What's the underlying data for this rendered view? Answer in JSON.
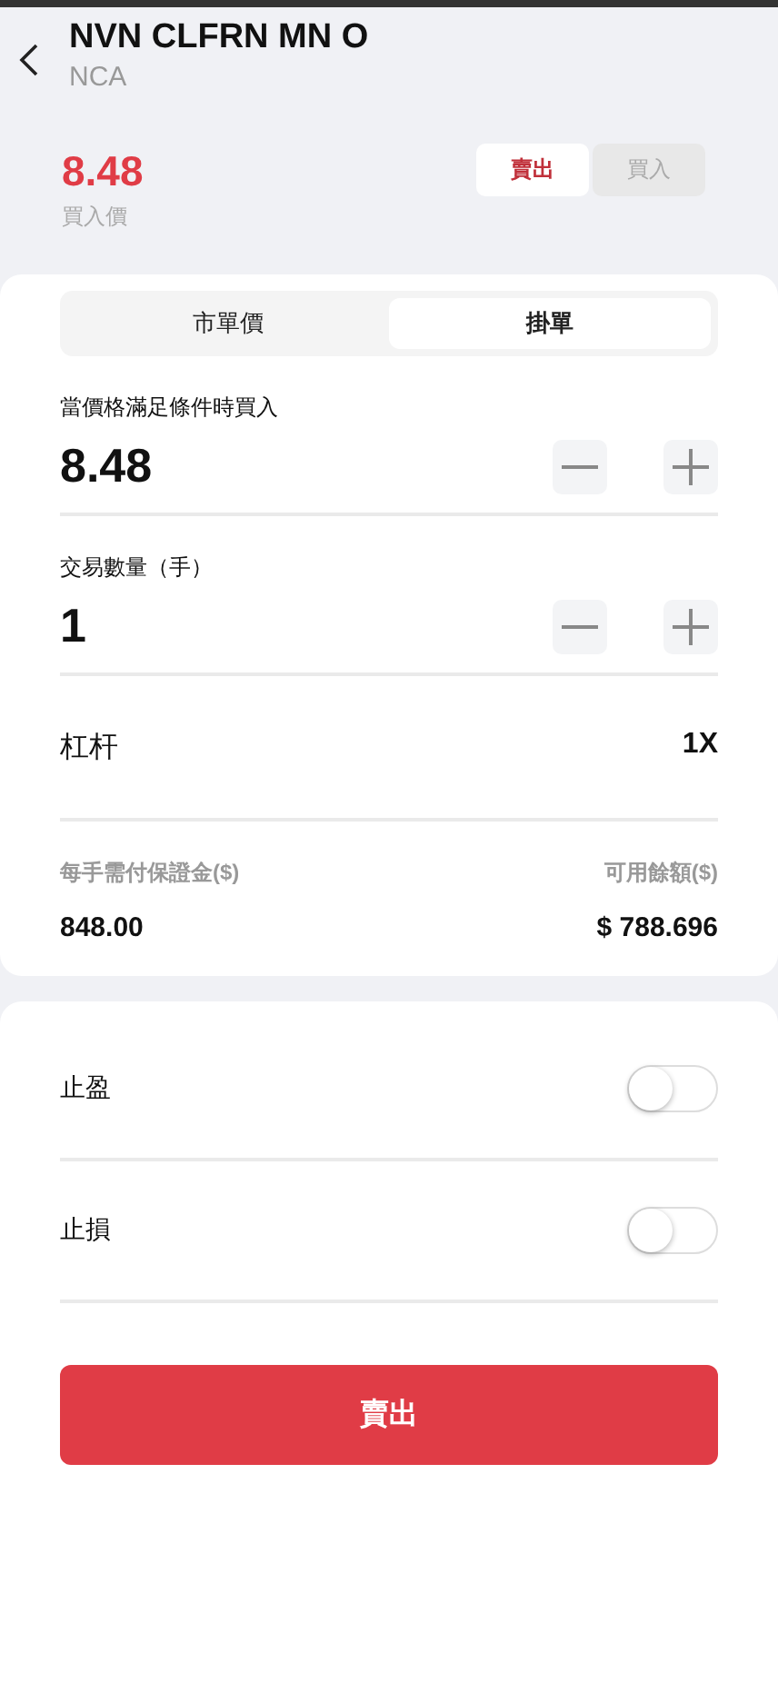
{
  "header": {
    "title": "NVN CLFRN MN O",
    "subtitle": "NCA"
  },
  "price": {
    "value": "8.48",
    "label": "買入價"
  },
  "side_tabs": [
    {
      "label": "賣出",
      "selected": true
    },
    {
      "label": "買入",
      "selected": false
    }
  ],
  "order_tabs": [
    {
      "label": "市單價",
      "selected": false
    },
    {
      "label": "掛單",
      "selected": true
    }
  ],
  "steppers": [
    {
      "label": "當價格滿足條件時買入",
      "value": "8.48"
    },
    {
      "label": "交易數量（手）",
      "value": "1"
    }
  ],
  "leverage": {
    "label": "杠杆",
    "value": "1X"
  },
  "margin": {
    "label": "每手需付保證金($)",
    "value": "848.00"
  },
  "balance": {
    "label": "可用餘額($)",
    "value": "$ 788.696"
  },
  "toggles": [
    {
      "label": "止盈",
      "on": false
    },
    {
      "label": "止損",
      "on": false
    }
  ],
  "submit": {
    "label": "賣出"
  }
}
